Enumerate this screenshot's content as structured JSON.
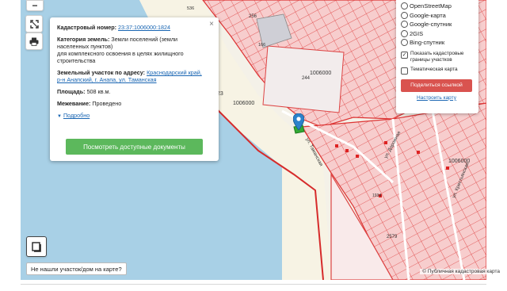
{
  "popup": {
    "close_symbol": "×",
    "cad_number_label": "Кадастровый номер:",
    "cad_number_value": "23:37:1006000:1824",
    "category_label": "Категория земель:",
    "category_value_line1": "Земли поселений (земли",
    "category_value_line2": "населенных пунктов)",
    "category_value_line3": "для комплексного освоения в целях жилищного",
    "category_value_line4": "строительства",
    "address_label": "Земельный участок по адресу:",
    "address_value_line1": "Краснодарский край,",
    "address_value_line2": "р-н Анапский, г. Анапа, ул. Таманская",
    "area_label": "Площадь:",
    "area_value": "508 кв.м.",
    "survey_label": "Межевание:",
    "survey_value": "Проведено",
    "more_link": "Подробно",
    "more_arrow": "▼",
    "docs_button": "Посмотреть доступные документы"
  },
  "layers": {
    "options": [
      "OpenStreetMap",
      "Google-карта",
      "Google-спутник",
      "2GIS",
      "Bing-спутник"
    ],
    "checkbox_cadastre_line1": "Показать кадастровые",
    "checkbox_cadastre_line2": "границы участков",
    "checkbox_cadastre_checked": true,
    "checkbox_cadastre_mark": "✓",
    "checkbox_thematic": "Тематическая карта",
    "checkbox_thematic_checked": false,
    "share_button": "Поделиться ссылкой",
    "setup_link": "Настроить карту"
  },
  "controls": {
    "zoom_out_symbol": "−",
    "fullscreen_icon": "expand-icon",
    "print_icon": "printer-icon",
    "legend_icon": "book-icon"
  },
  "not_found_button": "Не нашли участок/дом на карте?",
  "attribution": "© Публичная кадастровая карта",
  "map_labels": {
    "block_1006000_a": "1006000",
    "block_1006000_b": "1006000",
    "block_1006000_c": "1006000",
    "parcel_256": "256",
    "parcel_244": "244",
    "parcel_166": "166",
    "parcel_23": "23",
    "parcel_2579": "2579",
    "parcel_1934": "1934",
    "parcel_536": "536",
    "street_tamanskaya": "ул. Таманская",
    "street_dorozhnaya": "ул. Дорожная",
    "street_krestyanskaya": "ул. Крестьянская"
  },
  "colors": {
    "sea": "#a8d0e6",
    "parcel_fill": "#f6c9c9",
    "parcel_stroke": "#e05555",
    "share_button": "#d9534f",
    "docs_button": "#5cb85c",
    "marker": "#2b82cb",
    "selected_parcel": "#33aa33"
  }
}
